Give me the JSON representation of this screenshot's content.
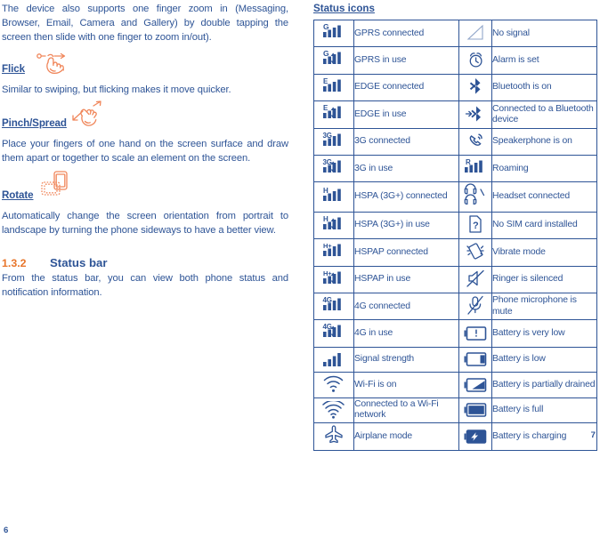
{
  "document": {
    "left_page_number": "6",
    "right_page_number": "7"
  },
  "left": {
    "intro_paragraph": "The device also supports one finger zoom in (Messaging, Browser, Email, Camera and Gallery) by double tapping the screen then slide with one finger to zoom in/out).",
    "gestures": [
      {
        "heading": "Flick",
        "icon": "flick-hand-icon",
        "description": "Similar to swiping, but flicking makes it move quicker."
      },
      {
        "heading": "Pinch/Spread",
        "icon": "pinch-spread-hand-icon",
        "description": "Place your fingers of one hand on the screen surface and draw them apart or together to scale an element on the screen."
      },
      {
        "heading": "Rotate",
        "icon": "rotate-phone-icon",
        "description": "Automatically change the screen orientation from portrait to landscape by turning the phone sideways to have a better view."
      }
    ],
    "section": {
      "number": "1.3.2",
      "title": "Status bar",
      "body": "From the status bar, you can view both phone status and notification information."
    }
  },
  "right": {
    "table_title": "Status icons",
    "rows": [
      {
        "left_icon": "gprs-connected-icon",
        "left_label": "GPRS connected",
        "right_icon": "no-signal-icon",
        "right_label": "No signal"
      },
      {
        "left_icon": "gprs-in-use-icon",
        "left_label": "GPRS in use",
        "right_icon": "alarm-clock-icon",
        "right_label": "Alarm is set"
      },
      {
        "left_icon": "edge-connected-icon",
        "left_label": "EDGE connected",
        "right_icon": "bluetooth-icon",
        "right_label": "Bluetooth is on"
      },
      {
        "left_icon": "edge-in-use-icon",
        "left_label": "EDGE in use",
        "right_icon": "bluetooth-connected-icon",
        "right_label": "Connected to a Bluetooth device"
      },
      {
        "left_icon": "3g-connected-icon",
        "left_label": "3G connected",
        "right_icon": "speakerphone-icon",
        "right_label": "Speakerphone is on"
      },
      {
        "left_icon": "3g-in-use-icon",
        "left_label": "3G in use",
        "right_icon": "roaming-icon",
        "right_label": "Roaming"
      },
      {
        "left_icon": "hspa-connected-icon",
        "left_label": "HSPA (3G+) connected",
        "right_icon": "headset-icon",
        "right_label": "Headset connected"
      },
      {
        "left_icon": "hspa-in-use-icon",
        "left_label": "HSPA (3G+) in use",
        "right_icon": "no-sim-card-icon",
        "right_label": "No SIM card installed"
      },
      {
        "left_icon": "hspap-connected-icon",
        "left_label": "HSPAP connected",
        "right_icon": "vibrate-icon",
        "right_label": "Vibrate mode"
      },
      {
        "left_icon": "hspap-in-use-icon",
        "left_label": "HSPAP in use",
        "right_icon": "ringer-silenced-icon",
        "right_label": "Ringer is silenced"
      },
      {
        "left_icon": "4g-connected-icon",
        "left_label": "4G connected",
        "right_icon": "microphone-mute-icon",
        "right_label": "Phone microphone is mute"
      },
      {
        "left_icon": "4g-in-use-icon",
        "left_label": "4G in use",
        "right_icon": "battery-very-low-icon",
        "right_label": "Battery is very low"
      },
      {
        "left_icon": "signal-strength-icon",
        "left_label": "Signal strength",
        "right_icon": "battery-low-icon",
        "right_label": "Battery is low"
      },
      {
        "left_icon": "wifi-on-icon",
        "left_label": "Wi-Fi is on",
        "right_icon": "battery-partial-icon",
        "right_label": "Battery is partially drained"
      },
      {
        "left_icon": "wifi-connected-icon",
        "left_label": "Connected to a Wi-Fi network",
        "right_icon": "battery-full-icon",
        "right_label": "Battery is full"
      },
      {
        "left_icon": "airplane-mode-icon",
        "left_label": "Airplane mode",
        "right_icon": "battery-charging-icon",
        "right_label": "Battery is charging"
      }
    ]
  },
  "colors": {
    "text_blue": "#2E5496",
    "accent_orange": "#E8762C"
  }
}
